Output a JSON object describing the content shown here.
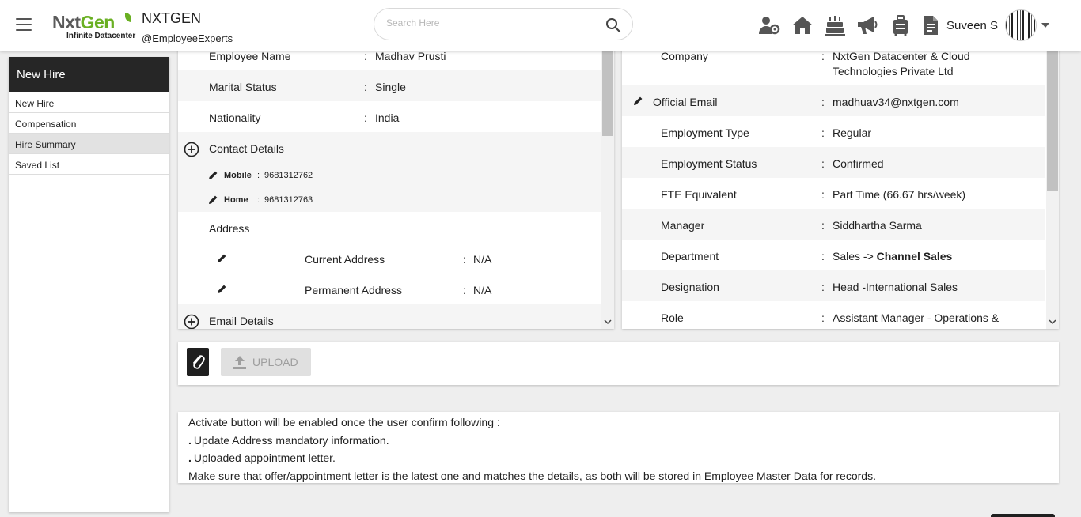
{
  "header": {
    "logo_text_a": "Nxt",
    "logo_text_b": "Gen",
    "logo_sub": "Infinite Datacenter",
    "company_name": "NXTGEN",
    "company_handle": "@EmployeeExperts",
    "search_placeholder": "Search Here",
    "user_name": "Suveen S",
    "icons": [
      "team-settings-icon",
      "home-icon",
      "cake-icon",
      "megaphone-icon",
      "luggage-icon",
      "document-icon"
    ]
  },
  "sidebar": {
    "title": "New Hire",
    "items": [
      {
        "label": "New Hire",
        "active": false
      },
      {
        "label": "Compensation",
        "active": false
      },
      {
        "label": "Hire Summary",
        "active": true
      },
      {
        "label": "Saved List",
        "active": false
      }
    ]
  },
  "personal": {
    "employee_name": {
      "label": "Employee Name",
      "value": "Madhav Prusti"
    },
    "marital_status": {
      "label": "Marital Status",
      "value": "Single"
    },
    "nationality": {
      "label": "Nationality",
      "value": "India"
    },
    "contact": {
      "title": "Contact Details",
      "mobile_label": "Mobile",
      "mobile_value": "9681312762",
      "home_label": "Home",
      "home_value": "9681312763"
    },
    "address": {
      "title": "Address",
      "current_label": "Current Address",
      "current_value": "N/A",
      "permanent_label": "Permanent Address",
      "permanent_value": "N/A"
    },
    "email_title": "Email Details"
  },
  "employment": {
    "company": {
      "label": "Company",
      "value_line1": "NxtGen Datacenter & Cloud",
      "value_line2": "Technologies Private Ltd"
    },
    "official_email": {
      "label": "Official Email",
      "value": "madhuav34@nxtgen.com"
    },
    "employment_type": {
      "label": "Employment Type",
      "value": "Regular"
    },
    "employment_status": {
      "label": "Employment Status",
      "value": "Confirmed"
    },
    "fte": {
      "label": "FTE Equivalent",
      "value": "Part Time (66.67 hrs/week)"
    },
    "manager": {
      "label": "Manager",
      "value": "Siddhartha Sarma"
    },
    "department": {
      "label": "Department",
      "value_prefix": "Sales ->",
      "value_bold": "Channel Sales"
    },
    "designation": {
      "label": "Designation",
      "value": "Head -International Sales"
    },
    "role": {
      "label": "Role",
      "value": "Assistant Manager - Operations &"
    }
  },
  "colon": ":",
  "upload": {
    "label": "UPLOAD"
  },
  "info": {
    "line1": "Activate button will be enabled once the user confirm following :",
    "bullet": ".",
    "line2": "Update Address mandatory information.",
    "line3": "Uploaded appointment letter.",
    "line4": "Make sure that offer/appointment letter is the latest one and matches the details, as both will be stored in Employee Master Data for records."
  },
  "colors": {
    "sidebar_header": "#262626",
    "logo_green": "#6ab023",
    "row_shade": "#f5f5f5"
  }
}
